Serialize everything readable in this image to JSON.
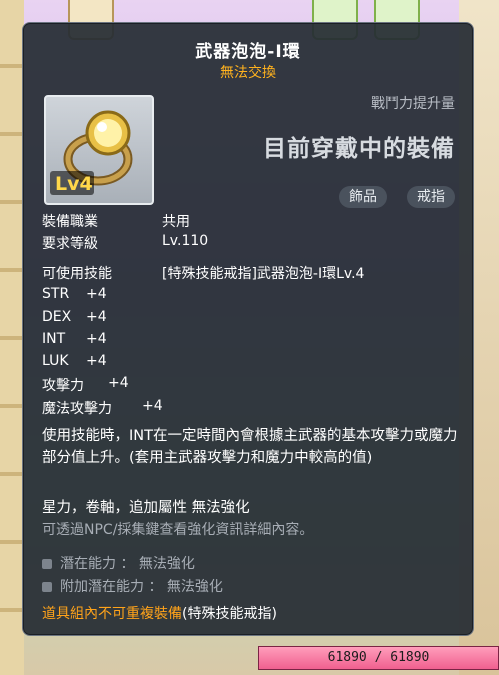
{
  "tooltip": {
    "title": "武器泡泡-I環",
    "trade": "無法交換",
    "cp_label": "戰鬥力提升量",
    "equipped_label": "目前穿戴中的裝備",
    "tags": [
      "飾品",
      "戒指"
    ],
    "level_badge": "Lv4",
    "job_label": "裝備職業",
    "job_value": "共用",
    "req_label": "要求等級",
    "req_value": "Lv.110",
    "skill_label": "可使用技能",
    "skill_value": "[特殊技能戒指]武器泡泡-I環Lv.4",
    "stats": [
      {
        "name": "STR",
        "value": "+4"
      },
      {
        "name": "DEX",
        "value": "+4"
      },
      {
        "name": "INT",
        "value": "+4"
      },
      {
        "name": "LUK",
        "value": "+4"
      },
      {
        "name": "攻擊力",
        "value": "+4"
      },
      {
        "name": "魔法攻擊力",
        "value": "+4"
      }
    ],
    "description": "使用技能時，INT在一定時間內會根據主武器的基本攻擊力或魔力部分值上升。(套用主武器攻擊力和魔力中較高的值)",
    "enhance_line": "星力，卷軸，追加屬性 無法強化",
    "help_line": "可透過NPC/採集鍵查看強化資訊詳細內容。",
    "potential": "潛在能力 ： 無法強化",
    "bonus_potential": "附加潛在能力 ： 無法強化",
    "set_note": "道具組內不可重複裝備",
    "set_note_suffix": "(特殊技能戒指)"
  },
  "hud": {
    "hp": "61890 / 61890"
  },
  "colors": {
    "title": "#ffffff",
    "accent": "#ffa31a",
    "panel": "#262c34"
  }
}
